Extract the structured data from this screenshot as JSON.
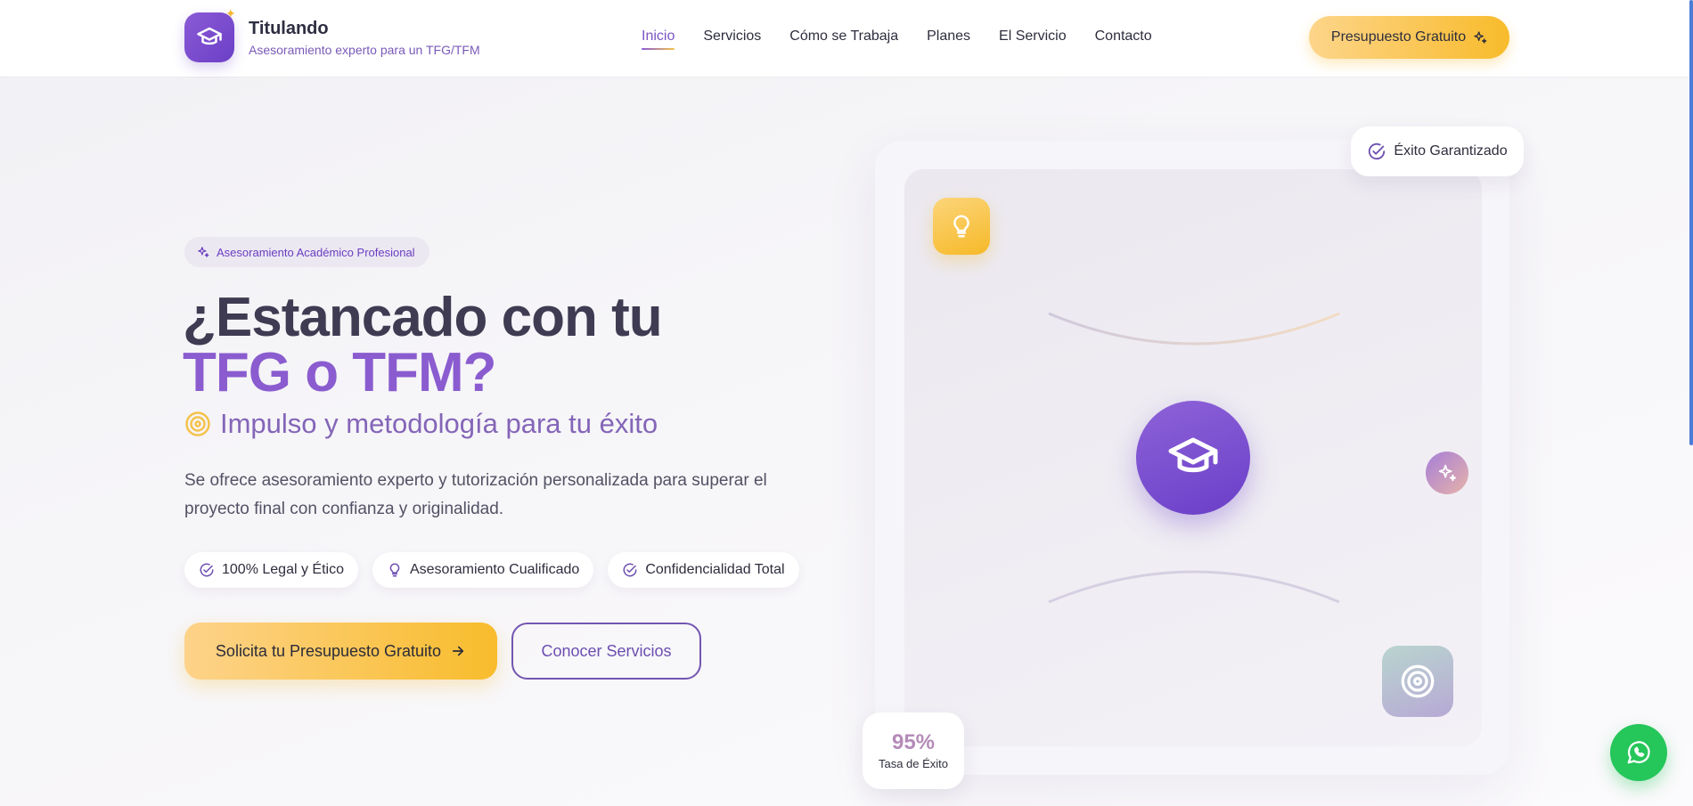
{
  "brand": {
    "name": "Titulando",
    "tagline": "Asesoramiento experto para un TFG/TFM",
    "logo_icon": "graduation-cap-icon"
  },
  "nav": {
    "items": [
      {
        "label": "Inicio",
        "active": true
      },
      {
        "label": "Servicios",
        "active": false
      },
      {
        "label": "Cómo se Trabaja",
        "active": false
      },
      {
        "label": "Planes",
        "active": false
      },
      {
        "label": "El Servicio",
        "active": false
      },
      {
        "label": "Contacto",
        "active": false
      }
    ],
    "cta_label": "Presupuesto Gratuito"
  },
  "hero": {
    "pill_label": "Asesoramiento Académico Profesional",
    "title_line1": "¿Estancado con tu",
    "title_line2": "TFG o TFM?",
    "subtitle": "Impulso y metodología para tu éxito",
    "description": "Se ofrece asesoramiento experto y tutorización personalizada para superar el proyecto final con confianza y originalidad.",
    "features": [
      {
        "label": "100% Legal y Ético",
        "icon": "check-circle-icon"
      },
      {
        "label": "Asesoramiento Cualificado",
        "icon": "lightbulb-icon"
      },
      {
        "label": "Confidencialidad Total",
        "icon": "check-circle-icon"
      }
    ],
    "primary_button": "Solicita tu Presupuesto Gratuito",
    "secondary_button": "Conocer Servicios"
  },
  "visual": {
    "badge_label": "Éxito Garantizado",
    "stat_value": "95%",
    "stat_label": "Tasa de Éxito"
  },
  "colors": {
    "accent_purple": "#7a55c4",
    "accent_yellow": "#f8bb2b",
    "whatsapp_green": "#25c65a"
  }
}
